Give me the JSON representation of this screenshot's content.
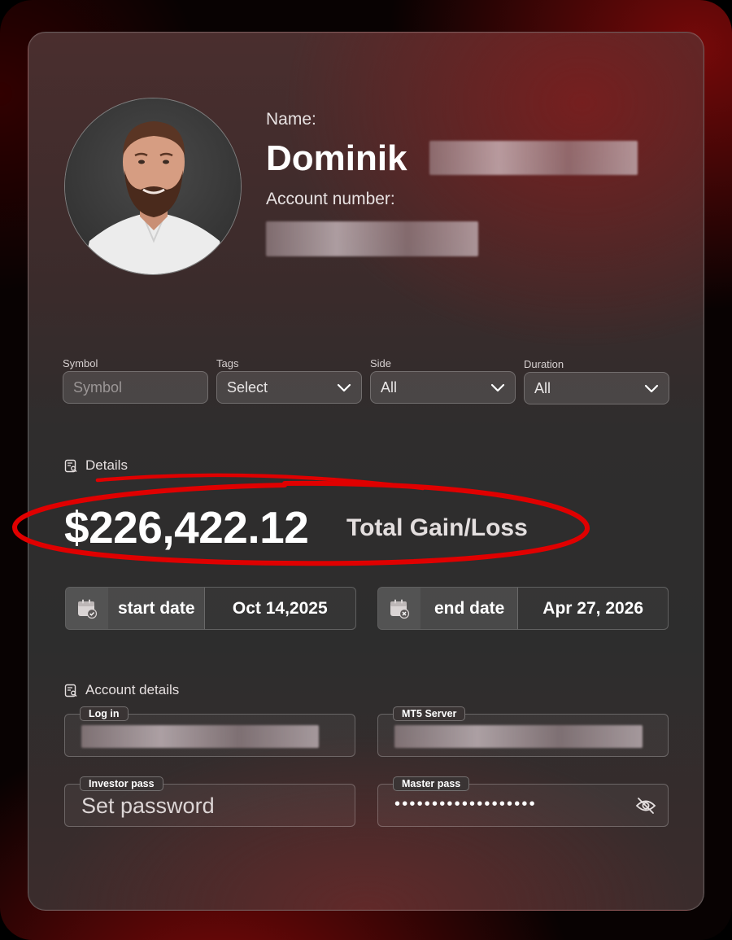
{
  "profile": {
    "name_label": "Name:",
    "first_name": "Dominik",
    "account_label": "Account number:"
  },
  "filters": {
    "symbol": {
      "label": "Symbol",
      "placeholder": "Symbol"
    },
    "tags": {
      "label": "Tags",
      "value": "Select"
    },
    "side": {
      "label": "Side",
      "value": "All"
    },
    "duration": {
      "label": "Duration",
      "value": "All"
    }
  },
  "details": {
    "heading": "Details",
    "amount": "$226,422.12",
    "amount_label": "Total Gain/Loss",
    "start": {
      "label": "start date",
      "value": "Oct 14,2025"
    },
    "end": {
      "label": "end date",
      "value": "Apr 27, 2026"
    }
  },
  "account_details": {
    "heading": "Account details",
    "login_label": "Log in",
    "server_label": "MT5 Server",
    "investor_label": "Investor pass",
    "investor_value": "Set password",
    "master_label": "Master pass",
    "master_value": "•••••••••••••••••••"
  },
  "colors": {
    "highlight_ring": "#e00000",
    "card_bg": "#2d2d2d"
  }
}
